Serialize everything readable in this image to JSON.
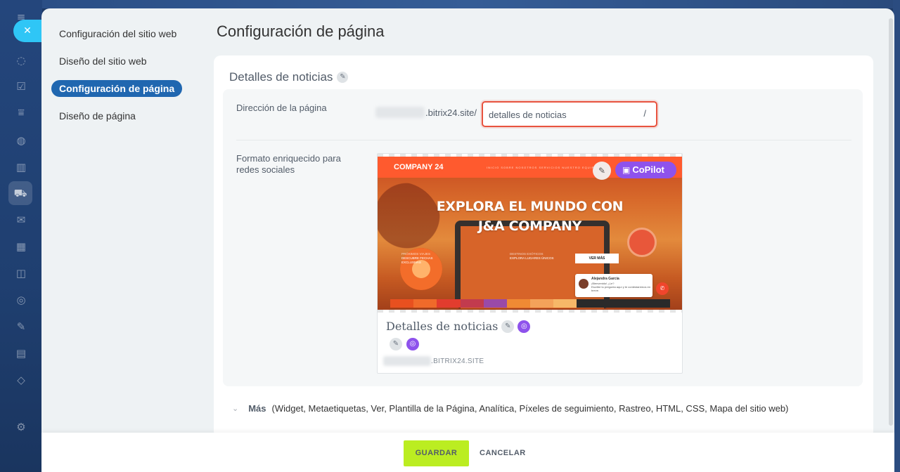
{
  "background_rail": {
    "icons": [
      "menu-icon",
      "chat-icon",
      "tasks-icon",
      "filter-icon",
      "robot-icon",
      "analytics-icon",
      "shop-icon",
      "mail-icon",
      "calendar-icon",
      "database-icon",
      "target-icon",
      "sign-icon",
      "document-icon",
      "cube-icon",
      "settings-icon"
    ]
  },
  "close_button": {
    "glyph": "✕"
  },
  "sidebar": {
    "items": [
      {
        "label": "Configuración del sitio web",
        "active": false
      },
      {
        "label": "Diseño del sitio web",
        "active": false
      },
      {
        "label": "Configuración de página",
        "active": true
      },
      {
        "label": "Diseño de página",
        "active": false
      }
    ]
  },
  "header": {
    "title": "Configuración de página"
  },
  "card": {
    "title": "Detalles de noticias",
    "address": {
      "label": "Dirección de la página",
      "domain_suffix": ".bitrix24.site/",
      "value": "detalles de noticias",
      "trailing_slash": "/"
    },
    "social": {
      "label": "Formato enriquecido para redes sociales",
      "preview": {
        "brand": "COMPANY 24",
        "menu": "INICIO   SOBRE NOSOTROS   SERVICIOS   NUESTRO EQUIPO",
        "heading_line1": "EXPLORA EL MUNDO CON",
        "heading_line2": "J&A COMPANY",
        "feature1_title": "PRÓXIMOS VIAJES",
        "feature1_text": "DESCUBRE FECHAS EXCLUSIVAS",
        "feature2_title": "DESTINOS EXÓTICOS",
        "feature2_text": "EXPLORA LUGARES ÚNICOS",
        "button": "VER MÁS",
        "chat_name": "Alejandra García",
        "chat_status": "¡Bienvenido! ¿Le?",
        "chat_text": "Escribe tu pregunta aquí y te contestaremos en breve.",
        "copilot_label": "CoPilot",
        "title": "Detalles de noticias",
        "url": ".BITRIX24.SITE",
        "palette": [
          "#e8501f",
          "#f06a2a",
          "#e23c2e",
          "#c23b4e",
          "#9a4aa8",
          "#f08a34",
          "#f4a25a",
          "#f7b868",
          "#2a2a2a",
          "#2a2a2a",
          "#2a2a2a",
          "#2a2a2a"
        ]
      }
    },
    "more": {
      "label": "Más",
      "items": "(Widget,  Metaetiquetas,  Ver,  Plantilla de la Página,  Analítica,  Píxeles de seguimiento,  Rastreo,  HTML,  CSS,  Mapa del sitio web)"
    }
  },
  "footer": {
    "save_label": "GUARDAR",
    "cancel_label": "CANCELAR"
  },
  "colors": {
    "accent": "#2067b0",
    "save": "#bbed21",
    "copilot": "#8e52ec",
    "highlight": "#e8533f"
  }
}
